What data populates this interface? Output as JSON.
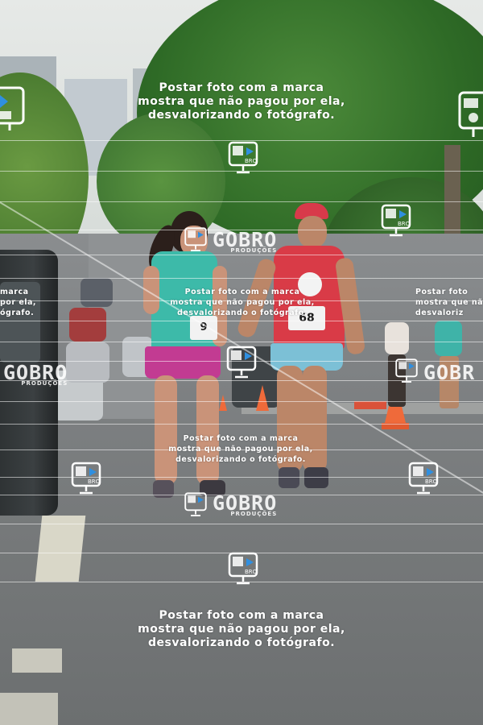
{
  "photo": {
    "subject": "Two women runners smiling on a street during a race"
  },
  "bibs": {
    "left_runner": "9",
    "right_runner": "68"
  },
  "watermark": {
    "notice": "Postar foto com a marca\nmostra que não pagou por ela,\ndesvalorizando o fotógrafo.",
    "notice_left_partial": "marca\npor ela,\nógrafo.",
    "notice_right_partial": "Postar foto\nmostra que nã\ndesvaloriz",
    "brand": "GOBRO",
    "brand_sub": "PRODUÇÕES",
    "brand_right_partial": "GOBR",
    "cam_label": "BRO",
    "color": "#ffffff"
  }
}
